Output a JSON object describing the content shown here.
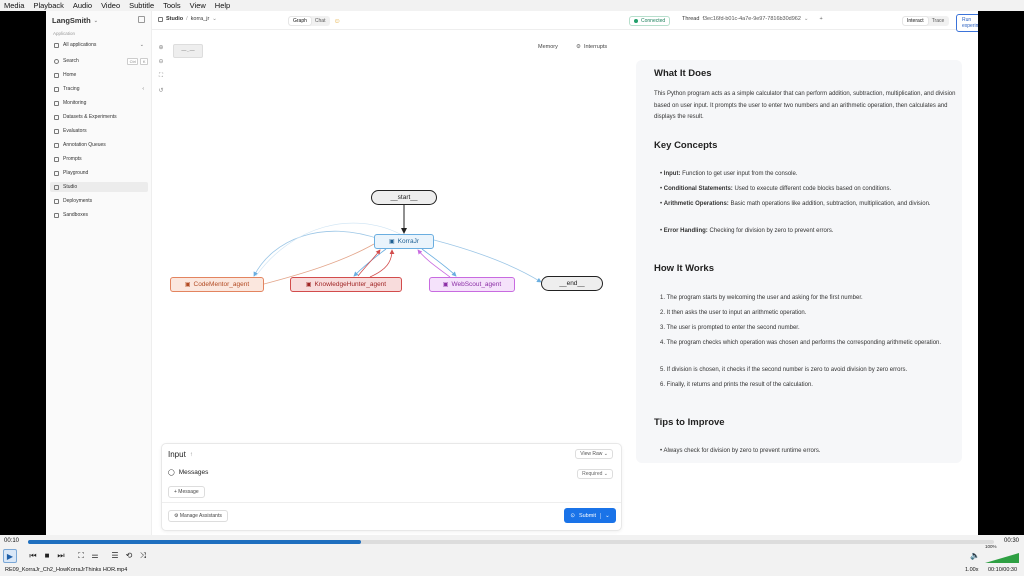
{
  "menubar": [
    "Media",
    "Playback",
    "Audio",
    "Video",
    "Subtitle",
    "Tools",
    "View",
    "Help"
  ],
  "sidebar": {
    "brand": "LangSmith",
    "section": "Application",
    "workspace": "All applications",
    "search_label": "Search",
    "search_kbd": [
      "Ctrl",
      "K"
    ],
    "items": [
      {
        "label": "Home"
      },
      {
        "label": "Tracing"
      },
      {
        "label": "Monitoring"
      },
      {
        "label": "Datasets & Experiments"
      },
      {
        "label": "Evaluators"
      },
      {
        "label": "Annotation Queues"
      },
      {
        "label": "Prompts"
      },
      {
        "label": "Playground"
      },
      {
        "label": "Studio"
      },
      {
        "label": "Deployments"
      },
      {
        "label": "Sandboxes"
      }
    ],
    "active_item": "Studio"
  },
  "topbar": {
    "studio": "Studio",
    "sep": "/",
    "project": "korra_jr",
    "tabs": [
      "Graph",
      "Chat"
    ],
    "active_tab": "Graph",
    "status": "Connected",
    "thread_label": "Thread",
    "thread_id": "f3ec16fd-b01c-4a7e-9e97-7816b30d962",
    "plus": "+",
    "modes": [
      "Interact",
      "Trace"
    ],
    "active_mode": "Interact",
    "run_experiment": "Run experiment"
  },
  "graph": {
    "memory": "Memory",
    "interrupts": "Interrupts",
    "nodes": {
      "start": "__start__",
      "korra": "KorraJr",
      "code": "CodeMentor_agent",
      "know": "KnowledgeHunter_agent",
      "web": "WebScout_agent",
      "end": "__end__"
    }
  },
  "input": {
    "title": "Input",
    "view_raw": "View Raw",
    "messages": "Messages",
    "required": "Required",
    "add_message": "+ Message",
    "manage": "Manage Assistants",
    "submit": "Submit"
  },
  "doc": {
    "h1": "What It Does",
    "p1": "This Python program acts as a simple calculator that can perform addition, subtraction, multiplication, and division based on user input. It prompts the user to enter two numbers and an arithmetic operation, then calculates and displays the result.",
    "h2": "Key Concepts",
    "concepts": [
      {
        "term": "Input:",
        "text": " Function to get user input from the console."
      },
      {
        "term": "Conditional Statements:",
        "text": " Used to execute different code blocks based on conditions."
      },
      {
        "term": "Arithmetic Operations:",
        "text": " Basic math operations like addition, subtraction, multiplication, and division."
      },
      {
        "term": "Error Handling:",
        "text": " Checking for division by zero to prevent errors."
      }
    ],
    "h3": "How It Works",
    "steps": [
      "1. The program starts by welcoming the user and asking for the first number.",
      "2. It then asks the user to input an arithmetic operation.",
      "3. The user is prompted to enter the second number.",
      "4. The program checks which operation was chosen and performs the corresponding arithmetic operation.",
      "5. If division is chosen, it checks if the second number is zero to avoid division by zero errors.",
      "6. Finally, it returns and prints the result of the calculation."
    ],
    "h4": "Tips to Improve",
    "tips": [
      "Always check for division by zero to prevent runtime errors."
    ]
  },
  "player": {
    "time_elapsed": "00:10",
    "time_total": "00:30",
    "progress": 0.345,
    "filename": "RE09_KorraJr_Ch2_HowKorraJrThinks HOR.mp4",
    "speed": "1.00x",
    "time_display": "00:10/00:30",
    "volume": "100%"
  }
}
